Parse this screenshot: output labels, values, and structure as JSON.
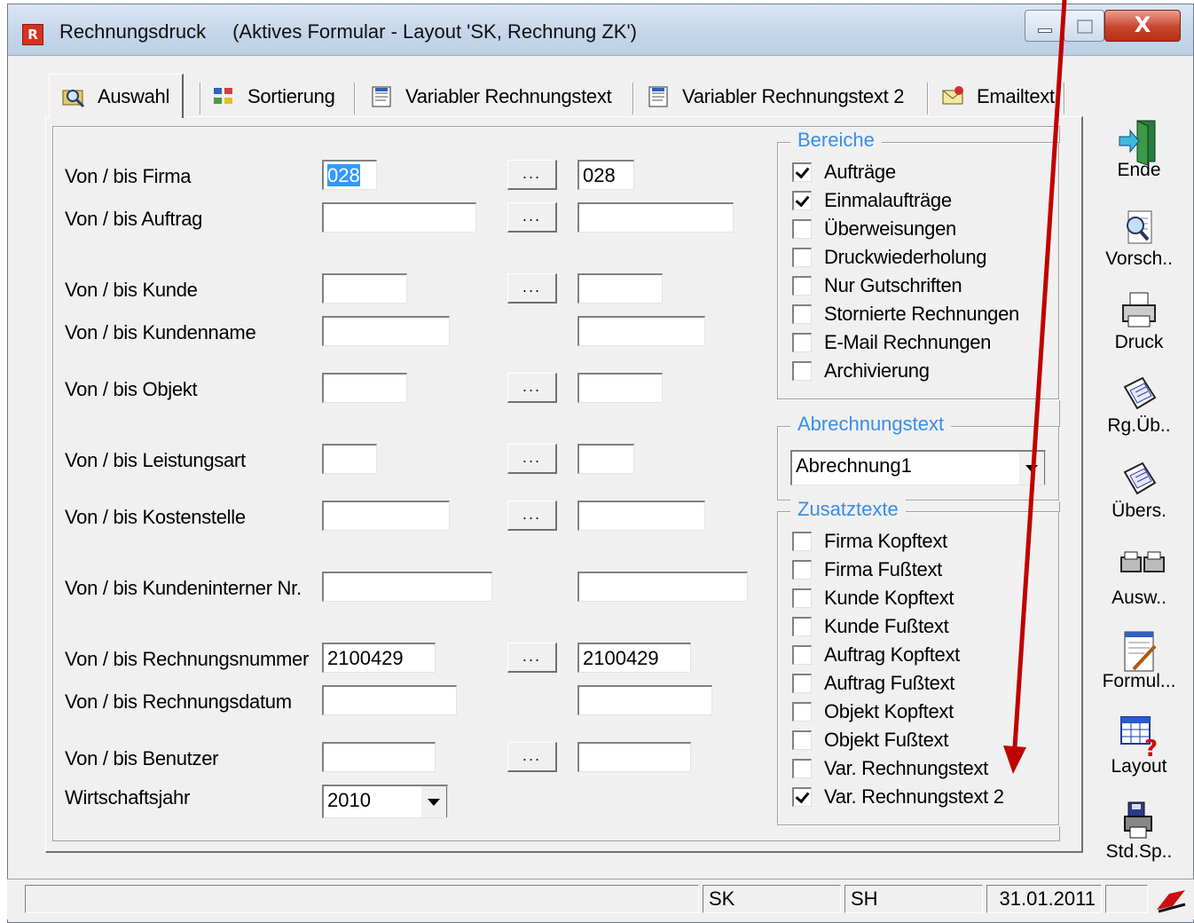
{
  "window": {
    "title": "Rechnungsdruck",
    "subtitle": "(Aktives Formular - Layout 'SK, Rechnung ZK')",
    "close_glyph": "X"
  },
  "tabs": [
    {
      "label": "Auswahl",
      "icon": "search-icon",
      "active": true
    },
    {
      "label": "Sortierung",
      "icon": "sort-icon",
      "active": false
    },
    {
      "label": "Variabler Rechnungstext",
      "icon": "text-document-icon",
      "active": false
    },
    {
      "label": "Variabler Rechnungstext 2",
      "icon": "text-document-icon",
      "active": false
    },
    {
      "label": "Emailtext",
      "icon": "email-icon",
      "active": false
    }
  ],
  "form": {
    "dots_label": "...",
    "rows": [
      {
        "label": "Von / bis Firma",
        "from": "028",
        "to": "028"
      },
      {
        "label": "Von / bis Auftrag",
        "from": "",
        "to": ""
      },
      {
        "label": "Von / bis Kunde",
        "from": "",
        "to": ""
      },
      {
        "label": "Von / bis Kundenname",
        "from": "",
        "to": ""
      },
      {
        "label": "Von / bis Objekt",
        "from": "",
        "to": ""
      },
      {
        "label": "Von / bis Leistungsart",
        "from": "",
        "to": ""
      },
      {
        "label": "Von / bis Kostenstelle",
        "from": "",
        "to": ""
      },
      {
        "label": "Von / bis Kundeninterner Nr.",
        "from": "",
        "to": ""
      },
      {
        "label": "Von / bis Rechnungsnummer",
        "from": "2100429",
        "to": "2100429"
      },
      {
        "label": "Von / bis Rechnungsdatum",
        "from": "",
        "to": ""
      },
      {
        "label": "Von / bis Benutzer",
        "from": "",
        "to": ""
      }
    ],
    "wirtschaftsjahr": {
      "label": "Wirtschaftsjahr",
      "value": "2010"
    }
  },
  "bereiche": {
    "title": "Bereiche",
    "items": [
      {
        "label": "Aufträge",
        "checked": true
      },
      {
        "label": "Einmalaufträge",
        "checked": true
      },
      {
        "label": "Überweisungen",
        "checked": false
      },
      {
        "label": "Druckwiederholung",
        "checked": false
      },
      {
        "label": "Nur Gutschriften",
        "checked": false
      },
      {
        "label": "Stornierte Rechnungen",
        "checked": false
      },
      {
        "label": "E-Mail Rechnungen",
        "checked": false
      },
      {
        "label": "Archivierung",
        "checked": false
      }
    ]
  },
  "abrechnungstext": {
    "title": "Abrechnungstext",
    "value": "Abrechnung1"
  },
  "zusatztexte": {
    "title": "Zusatztexte",
    "items": [
      {
        "label": "Firma Kopftext",
        "checked": false
      },
      {
        "label": "Firma Fußtext",
        "checked": false
      },
      {
        "label": "Kunde Kopftext",
        "checked": false
      },
      {
        "label": "Kunde Fußtext",
        "checked": false
      },
      {
        "label": "Auftrag Kopftext",
        "checked": false
      },
      {
        "label": "Auftrag Fußtext",
        "checked": false
      },
      {
        "label": "Objekt Kopftext",
        "checked": false
      },
      {
        "label": "Objekt Fußtext",
        "checked": false
      },
      {
        "label": "Var. Rechnungstext",
        "checked": false
      },
      {
        "label": "Var. Rechnungstext 2",
        "checked": true
      }
    ]
  },
  "toolbar": [
    {
      "label": "Ende",
      "icon": "exit-door-icon"
    },
    {
      "label": "Vorsch..",
      "icon": "preview-magnifier-icon"
    },
    {
      "label": "Druck",
      "icon": "printer-icon"
    },
    {
      "label": "Rg.Üb..",
      "icon": "invoice-transfer-icon"
    },
    {
      "label": "Übers.",
      "icon": "overview-icon"
    },
    {
      "label": "Ausw..",
      "icon": "double-printer-icon"
    },
    {
      "label": "Formul...",
      "icon": "form-edit-icon"
    },
    {
      "label": "Layout",
      "icon": "layout-question-icon"
    },
    {
      "label": "Std.Sp..",
      "icon": "save-printer-icon"
    }
  ],
  "statusbar": {
    "company": "SK",
    "user": "SH",
    "date": "31.01.2011"
  },
  "colors": {
    "accent_blue": "#3a8ee6",
    "annotation_arrow": "#c00000",
    "close_red": "#c8452d"
  }
}
